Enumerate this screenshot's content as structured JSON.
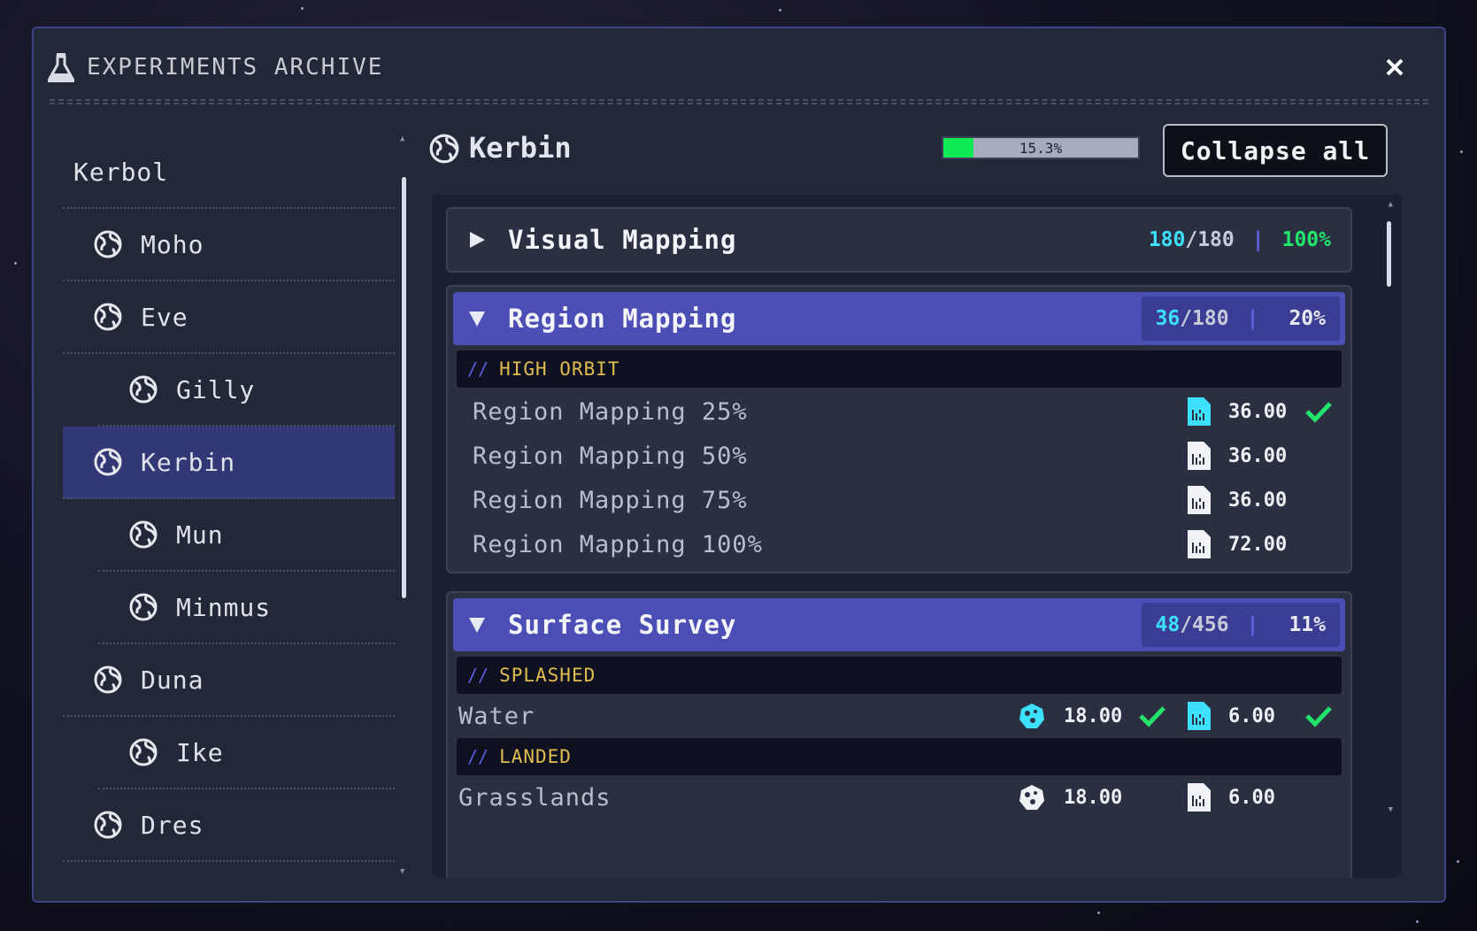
{
  "window": {
    "title": "EXPERIMENTS ARCHIVE",
    "close_icon": "close-icon"
  },
  "sidebar": {
    "items": [
      {
        "label": "Kerbol",
        "level": 0,
        "icon": ""
      },
      {
        "label": "Moho",
        "level": 1,
        "icon": "globe-icon"
      },
      {
        "label": "Eve",
        "level": 1,
        "icon": "globe-icon"
      },
      {
        "label": "Gilly",
        "level": 2,
        "icon": "globe-icon"
      },
      {
        "label": "Kerbin",
        "level": 1,
        "icon": "globe-icon",
        "selected": true
      },
      {
        "label": "Mun",
        "level": 2,
        "icon": "globe-icon"
      },
      {
        "label": "Minmus",
        "level": 2,
        "icon": "globe-icon"
      },
      {
        "label": "Duna",
        "level": 1,
        "icon": "globe-icon"
      },
      {
        "label": "Ike",
        "level": 2,
        "icon": "globe-icon"
      },
      {
        "label": "Dres",
        "level": 1,
        "icon": "globe-icon"
      }
    ]
  },
  "header": {
    "body_name": "Kerbin",
    "progress_label": "15.3%",
    "progress_value": 0.153,
    "collapse_label": "Collapse all"
  },
  "experiments": [
    {
      "title": "Visual Mapping",
      "expanded": false,
      "got": "180",
      "total": "/180",
      "pct": "100%"
    },
    {
      "title": "Region Mapping",
      "expanded": true,
      "got": "36",
      "total": "/180",
      "pct": "20%",
      "situation": "HIGH ORBIT",
      "rows": [
        {
          "name": "Region Mapping 25%",
          "value": "36.00",
          "done": true
        },
        {
          "name": "Region Mapping 50%",
          "value": "36.00",
          "done": false
        },
        {
          "name": "Region Mapping 75%",
          "value": "36.00",
          "done": false
        },
        {
          "name": "Region Mapping 100%",
          "value": "72.00",
          "done": false
        }
      ]
    },
    {
      "title": "Surface Survey",
      "expanded": true,
      "got": "48",
      "total": "/456",
      "pct": "11%",
      "situations": [
        {
          "label": "SPLASHED",
          "rows": [
            {
              "name": "Water",
              "sample_value": "18.00",
              "sample_done": true,
              "data_value": "6.00",
              "data_done": true
            }
          ]
        },
        {
          "label": "LANDED",
          "rows": [
            {
              "name": "Grasslands",
              "sample_value": "18.00",
              "sample_done": false,
              "data_value": "6.00",
              "data_done": false
            }
          ]
        }
      ]
    }
  ],
  "colors": {
    "accent": "#4b4eb4",
    "collected": "#3ee0ff",
    "complete": "#22e46b",
    "situation": "#e0bd4e",
    "progress_fill": "#12ea55"
  }
}
